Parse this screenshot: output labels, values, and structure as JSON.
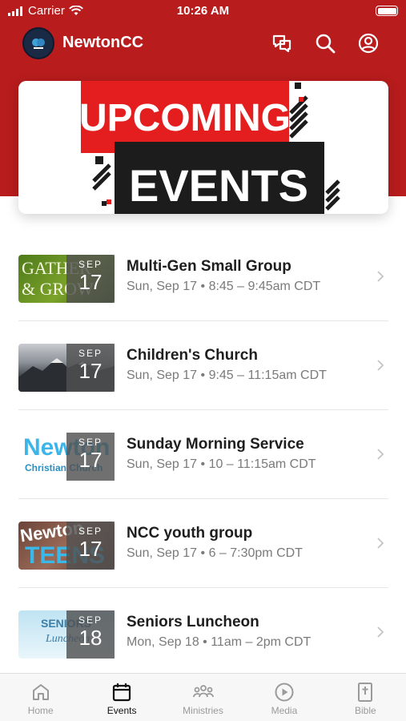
{
  "status_bar": {
    "carrier": "Carrier",
    "time": "10:26 AM"
  },
  "app_bar": {
    "title": "NewtonCC"
  },
  "banner": {
    "line1": "UPCOMING",
    "line2": "EVENTS"
  },
  "events": [
    {
      "title": "Multi-Gen Small Group",
      "meta": "Sun, Sep 17 • 8:45 – 9:45am CDT",
      "month": "SEP",
      "day": "17",
      "thumb_text1": "GATHER",
      "thumb_text2": "& GROW"
    },
    {
      "title": "Children's Church",
      "meta": "Sun, Sep 17 • 9:45 – 11:15am CDT",
      "month": "SEP",
      "day": "17"
    },
    {
      "title": "Sunday Morning Service",
      "meta": "Sun, Sep 17 • 10 – 11:15am CDT",
      "month": "SEP",
      "day": "17",
      "thumb_text1": "Newton",
      "thumb_text2": "Christian Church"
    },
    {
      "title": "NCC youth group",
      "meta": "Sun, Sep 17 • 6 – 7:30pm CDT",
      "month": "SEP",
      "day": "17",
      "thumb_text1": "Newton",
      "thumb_text2": "TEENS"
    },
    {
      "title": "Seniors Luncheon",
      "meta": "Mon, Sep 18 • 11am – 2pm CDT",
      "month": "SEP",
      "day": "18",
      "thumb_text1": "SENIORS",
      "thumb_text2": "Luncheon"
    }
  ],
  "tabs": [
    {
      "label": "Home",
      "icon": "home-icon",
      "active": false
    },
    {
      "label": "Events",
      "icon": "calendar-icon",
      "active": true
    },
    {
      "label": "Ministries",
      "icon": "people-icon",
      "active": false
    },
    {
      "label": "Media",
      "icon": "play-icon",
      "active": false
    },
    {
      "label": "Bible",
      "icon": "bible-icon",
      "active": false
    }
  ],
  "colors": {
    "brand_red": "#b81c1c",
    "banner_red": "#e41e1e",
    "banner_black": "#1c1c1c"
  }
}
